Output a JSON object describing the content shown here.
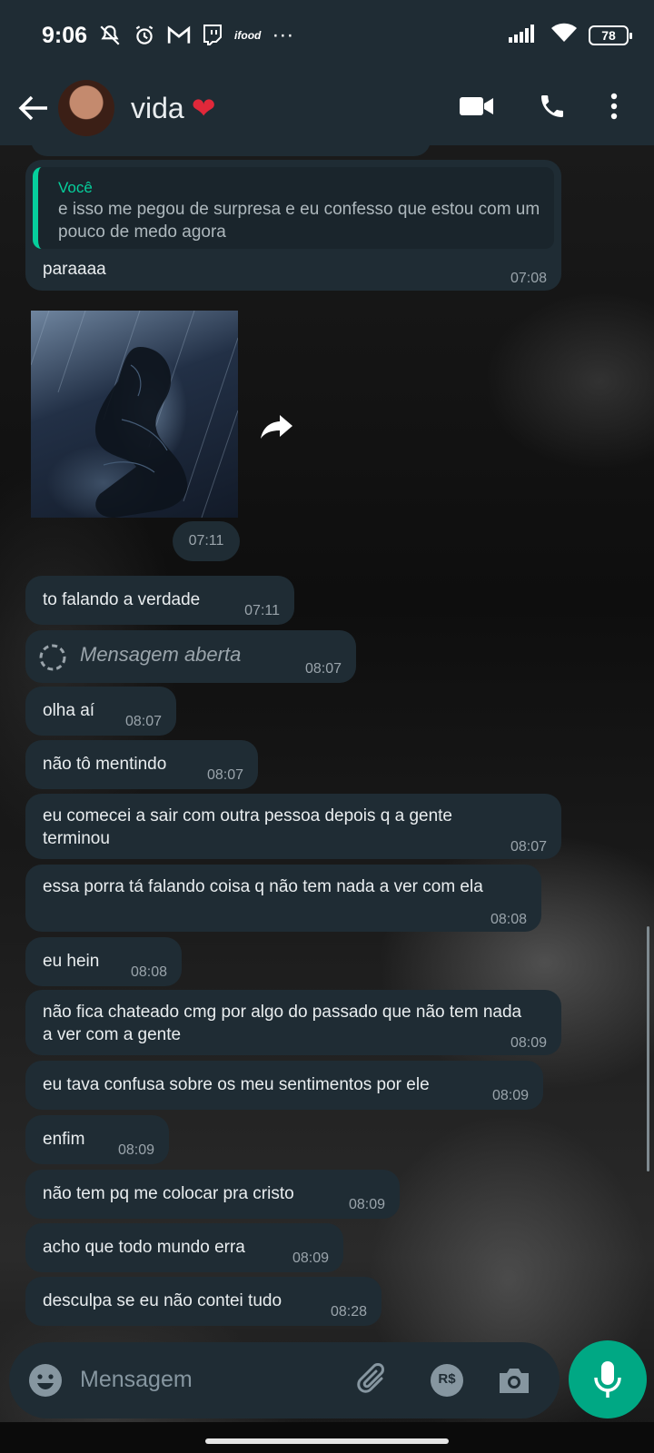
{
  "status_bar": {
    "time": "9:06",
    "left_icons": [
      "mute-icon",
      "alarm-icon",
      "gmail-icon",
      "twitch-icon",
      "ifood-icon"
    ],
    "ifood_label": "ifood",
    "more": "···",
    "battery": "78"
  },
  "header": {
    "contact_name": "vida",
    "heart": "❤"
  },
  "messages": [
    {
      "quote_author": "Você",
      "quote_text": "e isso me pegou de surpresa e eu confesso que estou com um pouco de medo agora",
      "text": "paraaaa",
      "time": "07:08"
    },
    {
      "type": "image",
      "time": "07:11"
    },
    {
      "text": "to falando a verdade",
      "time": "07:11"
    },
    {
      "text": "Mensagem aberta",
      "time": "08:07"
    },
    {
      "text": "olha aí",
      "time": "08:07"
    },
    {
      "text": "não tô mentindo",
      "time": "08:07"
    },
    {
      "text": "eu comecei a sair com outra pessoa depois q a gente terminou",
      "time": "08:07"
    },
    {
      "text": "essa porra tá falando coisa q não tem nada a ver com ela",
      "time": "08:08"
    },
    {
      "text": "eu hein",
      "time": "08:08"
    },
    {
      "text": "não fica chateado cmg por algo do passado que não tem nada a ver com a gente",
      "time": "08:09"
    },
    {
      "text": "eu tava confusa sobre os meu sentimentos por ele",
      "time": "08:09"
    },
    {
      "text": "enfim",
      "time": "08:09"
    },
    {
      "text": "não tem pq me colocar pra cristo",
      "time": "08:09"
    },
    {
      "text": "acho que todo mundo erra",
      "time": "08:09"
    },
    {
      "text": "desculpa se eu não contei tudo",
      "time": "08:28"
    }
  ],
  "input": {
    "placeholder": "Mensagem",
    "payment_label": "R$"
  },
  "colors": {
    "bubble": "#1f2c34",
    "accent": "#00a884",
    "quote_accent": "#06cf9c",
    "heart": "#e0283a"
  }
}
